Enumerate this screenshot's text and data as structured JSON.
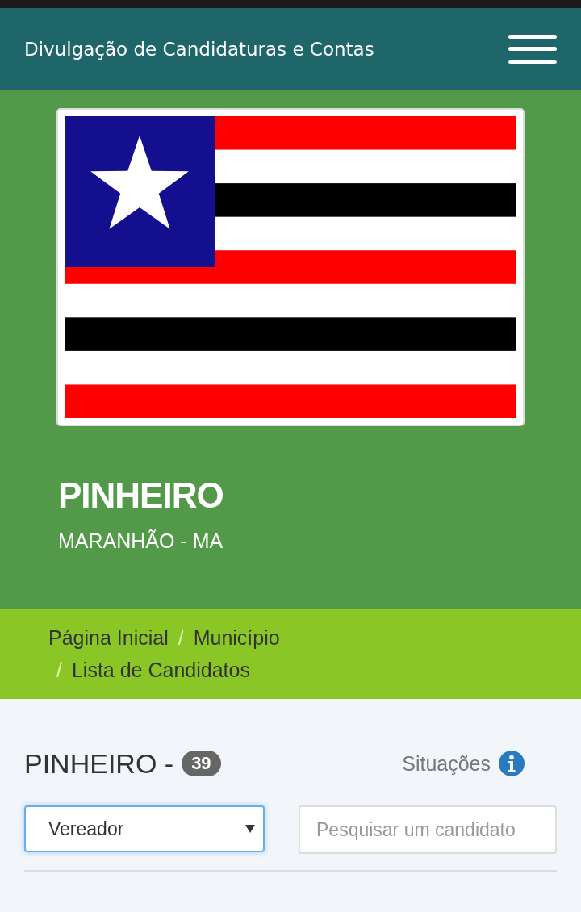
{
  "header": {
    "title": "Divulgação de Candidaturas e Contas"
  },
  "municipality": {
    "name": "PINHEIRO",
    "state": "MARANHÃO - MA"
  },
  "breadcrumb": {
    "separator": "/",
    "items": [
      {
        "label": "Página Inicial"
      },
      {
        "label": "Município"
      },
      {
        "label": "Lista de Candidatos"
      }
    ]
  },
  "list": {
    "title": "PINHEIRO -",
    "count": "39",
    "situations_label": "Situações"
  },
  "filters": {
    "office": {
      "value": "Vereador",
      "focused": true
    },
    "search": {
      "placeholder": "Pesquisar um candidato"
    }
  }
}
